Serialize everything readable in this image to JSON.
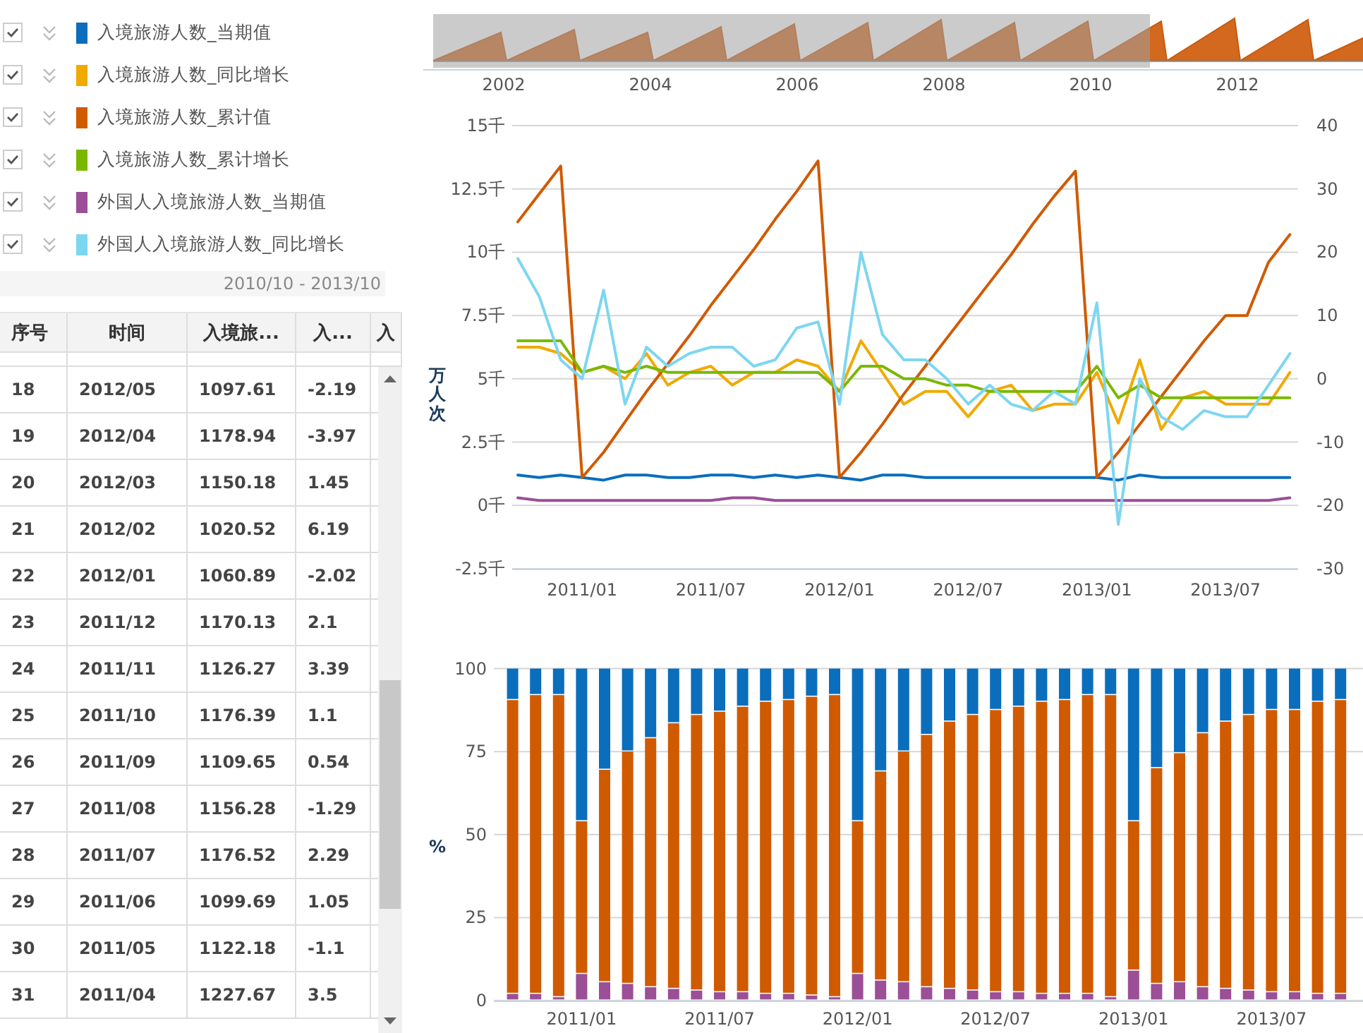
{
  "legend": [
    {
      "label": "入境旅游人数_当期值",
      "color": "#0a6ebd",
      "checked": true
    },
    {
      "label": "入境旅游人数_同比增长",
      "color": "#f0aa00",
      "checked": true
    },
    {
      "label": "入境旅游人数_累计值",
      "color": "#d05a00",
      "checked": true
    },
    {
      "label": "入境旅游人数_累计增长",
      "color": "#7ab800",
      "checked": true
    },
    {
      "label": "外国人入境旅游人数_当期值",
      "color": "#9b4f96",
      "checked": true
    },
    {
      "label": "外国人入境旅游人数_同比增长",
      "color": "#7dd6f0",
      "checked": true
    }
  ],
  "range_label": "2010/10 - 2013/10",
  "table": {
    "columns": [
      "序号",
      "时间",
      "入境旅...",
      "入...",
      "入"
    ],
    "rows": [
      {
        "cells": [
          "18",
          "2012/05",
          "1097.61",
          "-2.19"
        ]
      },
      {
        "cells": [
          "19",
          "2012/04",
          "1178.94",
          "-3.97"
        ]
      },
      {
        "cells": [
          "20",
          "2012/03",
          "1150.18",
          "1.45"
        ]
      },
      {
        "cells": [
          "21",
          "2012/02",
          "1020.52",
          "6.19"
        ]
      },
      {
        "cells": [
          "22",
          "2012/01",
          "1060.89",
          "-2.02"
        ]
      },
      {
        "cells": [
          "23",
          "2011/12",
          "1170.13",
          "2.1"
        ]
      },
      {
        "cells": [
          "24",
          "2011/11",
          "1126.27",
          "3.39"
        ]
      },
      {
        "cells": [
          "25",
          "2011/10",
          "1176.39",
          "1.1"
        ]
      },
      {
        "cells": [
          "26",
          "2011/09",
          "1109.65",
          "0.54"
        ]
      },
      {
        "cells": [
          "27",
          "2011/08",
          "1156.28",
          "-1.29"
        ]
      },
      {
        "cells": [
          "28",
          "2011/07",
          "1176.52",
          "2.29"
        ]
      },
      {
        "cells": [
          "29",
          "2011/06",
          "1099.69",
          "1.05"
        ]
      },
      {
        "cells": [
          "30",
          "2011/05",
          "1122.18",
          "-1.1"
        ]
      },
      {
        "cells": [
          "31",
          "2011/04",
          "1227.67",
          "3.5"
        ]
      }
    ]
  },
  "navigator": {
    "year_labels": [
      "2002",
      "2004",
      "2006",
      "2008",
      "2010",
      "2012"
    ]
  },
  "line_chart": {
    "chart_data": {
      "type": "line",
      "ylabel": "万人次",
      "grid": true,
      "categories": [
        null,
        null,
        null,
        "2011/01",
        null,
        null,
        null,
        null,
        null,
        "2011/07",
        null,
        null,
        null,
        null,
        null,
        "2012/01",
        null,
        null,
        null,
        null,
        null,
        "2012/07",
        null,
        null,
        null,
        null,
        null,
        "2013/01",
        null,
        null,
        null,
        null,
        null,
        "2013/07",
        null,
        null,
        null
      ],
      "ylim": [
        -2.5,
        15
      ],
      "yticks": [
        {
          "value": -2.5,
          "label": "-2.5千"
        },
        {
          "value": 0,
          "label": "0千"
        },
        {
          "value": 2.5,
          "label": "2.5千"
        },
        {
          "value": 5,
          "label": "5千"
        },
        {
          "value": 7.5,
          "label": "7.5千"
        },
        {
          "value": 10,
          "label": "10千"
        },
        {
          "value": 12.5,
          "label": "12.5千"
        },
        {
          "value": 15,
          "label": "15千"
        }
      ],
      "y2lim": [
        -30,
        40
      ],
      "y2ticks": [
        -30,
        -20,
        -10,
        0,
        10,
        20,
        30,
        40
      ],
      "series": [
        {
          "color": "#0a6ebd",
          "values": [
            1.2,
            1.1,
            1.2,
            1.1,
            1.0,
            1.2,
            1.2,
            1.1,
            1.1,
            1.2,
            1.2,
            1.1,
            1.2,
            1.1,
            1.2,
            1.1,
            1.0,
            1.2,
            1.2,
            1.1,
            1.1,
            1.1,
            1.1,
            1.1,
            1.1,
            1.1,
            1.1,
            1.1,
            1.0,
            1.2,
            1.1,
            1.1,
            1.1,
            1.1,
            1.1,
            1.1,
            1.1
          ]
        },
        {
          "color": "#f0aa00",
          "axis": "y2",
          "values": [
            5,
            5,
            4,
            1,
            2,
            0,
            4,
            -1,
            1,
            2,
            -1,
            1,
            1,
            3,
            2,
            -2,
            6,
            1,
            -4,
            -2,
            -2,
            -6,
            -2,
            -1,
            -5,
            -4,
            -4,
            1,
            -7,
            3,
            -8,
            -3,
            -2,
            -4,
            -4,
            -4,
            1
          ]
        },
        {
          "color": "#d05a00",
          "values": [
            11.2,
            12.3,
            13.4,
            1.1,
            2.1,
            3.3,
            4.5,
            5.6,
            6.7,
            7.9,
            9.0,
            10.1,
            11.3,
            12.4,
            13.6,
            1.1,
            2.1,
            3.2,
            4.4,
            5.5,
            6.6,
            7.7,
            8.8,
            9.9,
            11.1,
            12.2,
            13.2,
            1.1,
            2.1,
            3.2,
            4.3,
            5.4,
            6.5,
            7.5,
            7.5,
            9.6,
            10.7
          ]
        },
        {
          "color": "#7ab800",
          "axis": "y2",
          "values": [
            6,
            6,
            6,
            1,
            2,
            1,
            2,
            1,
            1,
            1,
            1,
            1,
            1,
            1,
            1,
            -2,
            2,
            2,
            0,
            0,
            -1,
            -1,
            -2,
            -2,
            -2,
            -2,
            -2,
            2,
            -3,
            -1,
            -3,
            -3,
            -3,
            -3,
            -3,
            -3,
            -3
          ]
        },
        {
          "color": "#9b4f96",
          "values": [
            0.3,
            0.2,
            0.2,
            0.2,
            0.2,
            0.2,
            0.2,
            0.2,
            0.2,
            0.2,
            0.3,
            0.3,
            0.2,
            0.2,
            0.2,
            0.2,
            0.2,
            0.2,
            0.2,
            0.2,
            0.2,
            0.2,
            0.2,
            0.2,
            0.2,
            0.2,
            0.2,
            0.2,
            0.2,
            0.2,
            0.2,
            0.2,
            0.2,
            0.2,
            0.2,
            0.2,
            0.3
          ]
        },
        {
          "color": "#7dd6f0",
          "axis": "y2",
          "values": [
            19,
            13,
            3,
            0,
            14,
            -4,
            5,
            2,
            4,
            5,
            5,
            2,
            3,
            8,
            9,
            -4,
            20,
            7,
            3,
            3,
            0,
            -4,
            -1,
            -4,
            -5,
            -2,
            -4,
            12,
            -23,
            0,
            -6,
            -8,
            -5,
            -6,
            -6,
            -1,
            4
          ]
        }
      ]
    }
  },
  "bar_chart": {
    "chart_data": {
      "type": "bar",
      "stacked": true,
      "ylabel": "%",
      "grid": true,
      "categories": [
        null,
        null,
        null,
        "2011/01",
        null,
        null,
        null,
        null,
        null,
        "2011/07",
        null,
        null,
        null,
        null,
        null,
        "2012/01",
        null,
        null,
        null,
        null,
        null,
        "2012/07",
        null,
        null,
        null,
        null,
        null,
        "2013/01",
        null,
        null,
        null,
        null,
        null,
        "2013/07",
        null,
        null,
        null
      ],
      "ylim": [
        0,
        100
      ],
      "yticks": [
        0,
        25,
        50,
        75,
        100
      ],
      "series": [
        {
          "color": "#9b4f96",
          "values": [
            2,
            2,
            1,
            8,
            5.5,
            5,
            4,
            3.5,
            3,
            2.5,
            2.5,
            2,
            2,
            1.5,
            1,
            8,
            6,
            5.5,
            4,
            3.5,
            3,
            2.5,
            2.5,
            2,
            2,
            2,
            1,
            9,
            5,
            5.5,
            4,
            3.5,
            3,
            2.5,
            2.5,
            2,
            2
          ]
        },
        {
          "color": "#d05a00",
          "values": [
            88.5,
            90,
            91,
            46,
            64,
            70,
            75,
            80,
            83,
            84.5,
            86,
            88,
            88.5,
            90,
            91,
            46,
            63,
            69.5,
            76,
            80.5,
            83,
            85,
            86,
            88,
            88.5,
            90,
            91,
            45,
            65,
            69,
            76.5,
            80.5,
            83,
            85,
            85,
            88,
            88.5
          ]
        },
        {
          "color": "#0a6ebd",
          "values": [
            9.5,
            8,
            8,
            46,
            30.5,
            25,
            21,
            16.5,
            14,
            13,
            11.5,
            10,
            9.5,
            8.5,
            8,
            46,
            31,
            25,
            20,
            16,
            14,
            12.5,
            11.5,
            10,
            9.5,
            8,
            8,
            46,
            30,
            25.5,
            19.5,
            16,
            14,
            12.5,
            12.5,
            10,
            9.5
          ]
        }
      ]
    }
  }
}
